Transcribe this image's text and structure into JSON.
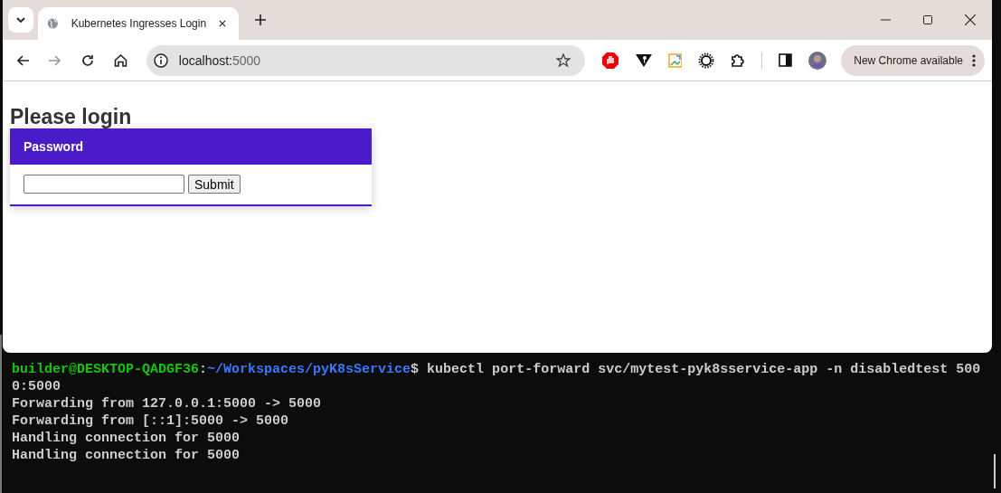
{
  "browser": {
    "tabs": [
      {
        "title": "Kubernetes Ingresses Login",
        "selected": true
      }
    ],
    "address": {
      "host": "localhost:",
      "port": "5000"
    },
    "update_button": "New Chrome available"
  },
  "page": {
    "heading": "Please login",
    "card": {
      "title": "Password",
      "submit": "Submit"
    }
  },
  "terminal": {
    "lines": [
      [
        {
          "text": "builder@DESKTOP-QADGF36",
          "kind": "user"
        },
        {
          "text": ":",
          "kind": "plain"
        },
        {
          "text": "~/Workspaces/pyK8sService",
          "kind": "path"
        },
        {
          "text": "$ kubectl port-forward svc/mytest-pyk8sservice-app -n disabledtest 500",
          "kind": "plain"
        }
      ],
      [
        {
          "text": "0:5000",
          "kind": "plain"
        }
      ],
      [
        {
          "text": "Forwarding from 127.0.0.1:5000 -> 5000",
          "kind": "plain"
        }
      ],
      [
        {
          "text": "Forwarding from [::1]:5000 -> 5000",
          "kind": "plain"
        }
      ],
      [
        {
          "text": "Handling connection for 5000",
          "kind": "plain"
        }
      ],
      [
        {
          "text": "Handling connection for 5000",
          "kind": "plain"
        }
      ]
    ]
  }
}
